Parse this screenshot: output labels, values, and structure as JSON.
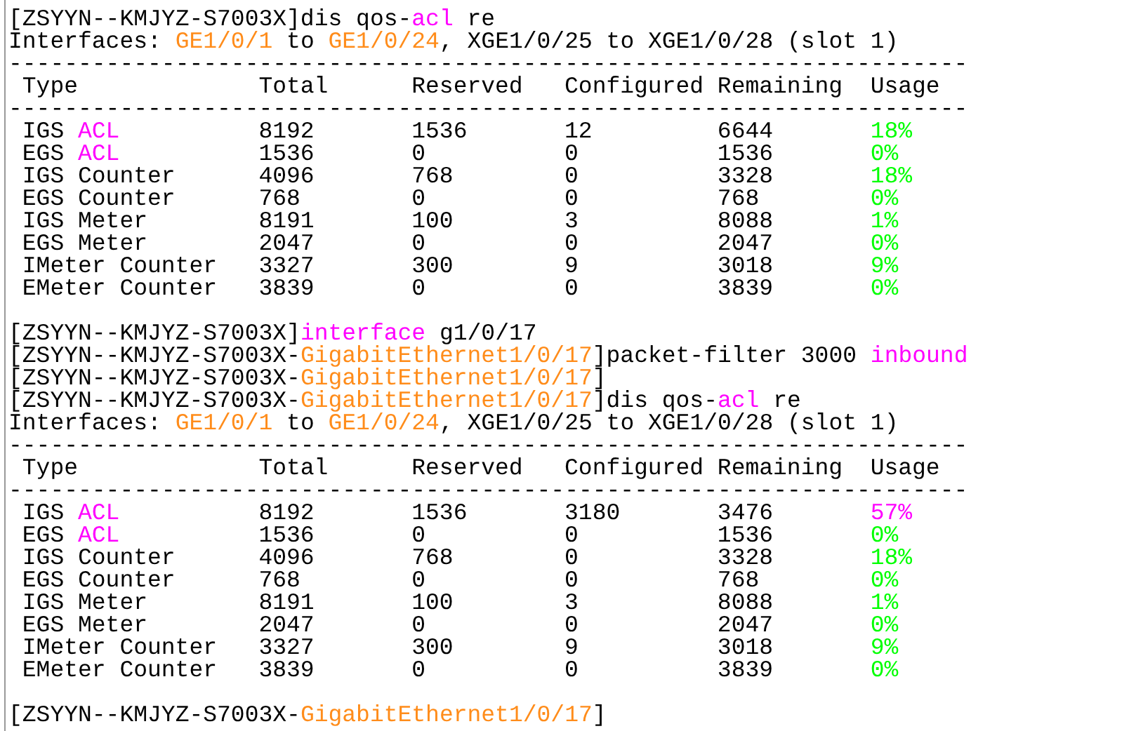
{
  "blocks": [
    {
      "kind": "line",
      "segments": [
        {
          "text": "[ZSYYN--KMJYZ-S7003X]dis qos-",
          "color": "#000000"
        },
        {
          "text": "acl",
          "color": "#ff00ff"
        },
        {
          "text": " re",
          "color": "#000000"
        }
      ]
    },
    {
      "kind": "line",
      "segments": [
        {
          "text": "Interfaces: ",
          "color": "#000000"
        },
        {
          "text": "GE1/0/1",
          "color": "#ff8c1a"
        },
        {
          "text": " to ",
          "color": "#000000"
        },
        {
          "text": "GE1/0/24",
          "color": "#ff8c1a"
        },
        {
          "text": ", XGE1/0/25 to XGE1/0/28 (slot 1)",
          "color": "#000000"
        }
      ]
    },
    {
      "kind": "table",
      "rule": "---------------------------------------------------------------------",
      "columns": [
        "Type",
        "Total",
        "Reserved",
        "Configured",
        "Remaining",
        "Usage"
      ],
      "rows": [
        {
          "type": [
            {
              "text": "IGS ",
              "color": "#000000"
            },
            {
              "text": "ACL",
              "color": "#ff00ff"
            }
          ],
          "total": "8192",
          "reserved": "1536",
          "configured": "12",
          "remaining": "6644",
          "usage": {
            "text": "18%",
            "color": "#00ff00"
          }
        },
        {
          "type": [
            {
              "text": "EGS ",
              "color": "#000000"
            },
            {
              "text": "ACL",
              "color": "#ff00ff"
            }
          ],
          "total": "1536",
          "reserved": "0",
          "configured": "0",
          "remaining": "1536",
          "usage": {
            "text": "0%",
            "color": "#00ff00"
          }
        },
        {
          "type": [
            {
              "text": "IGS Counter",
              "color": "#000000"
            }
          ],
          "total": "4096",
          "reserved": "768",
          "configured": "0",
          "remaining": "3328",
          "usage": {
            "text": "18%",
            "color": "#00ff00"
          }
        },
        {
          "type": [
            {
              "text": "EGS Counter",
              "color": "#000000"
            }
          ],
          "total": "768",
          "reserved": "0",
          "configured": "0",
          "remaining": "768",
          "usage": {
            "text": "0%",
            "color": "#00ff00"
          }
        },
        {
          "type": [
            {
              "text": "IGS Meter",
              "color": "#000000"
            }
          ],
          "total": "8191",
          "reserved": "100",
          "configured": "3",
          "remaining": "8088",
          "usage": {
            "text": "1%",
            "color": "#00ff00"
          }
        },
        {
          "type": [
            {
              "text": "EGS Meter",
              "color": "#000000"
            }
          ],
          "total": "2047",
          "reserved": "0",
          "configured": "0",
          "remaining": "2047",
          "usage": {
            "text": "0%",
            "color": "#00ff00"
          }
        },
        {
          "type": [
            {
              "text": "IMeter Counter",
              "color": "#000000"
            }
          ],
          "total": "3327",
          "reserved": "300",
          "configured": "9",
          "remaining": "3018",
          "usage": {
            "text": "9%",
            "color": "#00ff00"
          }
        },
        {
          "type": [
            {
              "text": "EMeter Counter",
              "color": "#000000"
            }
          ],
          "total": "3839",
          "reserved": "0",
          "configured": "0",
          "remaining": "3839",
          "usage": {
            "text": "0%",
            "color": "#00ff00"
          }
        }
      ]
    },
    {
      "kind": "blank"
    },
    {
      "kind": "line",
      "segments": [
        {
          "text": "[ZSYYN--KMJYZ-S7003X]",
          "color": "#000000"
        },
        {
          "text": "interface",
          "color": "#ff00ff"
        },
        {
          "text": " g1/0/17",
          "color": "#000000"
        }
      ]
    },
    {
      "kind": "line",
      "segments": [
        {
          "text": "[ZSYYN--KMJYZ-S7003X-",
          "color": "#000000"
        },
        {
          "text": "GigabitEthernet1/0/17",
          "color": "#ff8c1a"
        },
        {
          "text": "]packet-filter 3000 ",
          "color": "#000000"
        },
        {
          "text": "inbound",
          "color": "#ff00ff"
        }
      ]
    },
    {
      "kind": "line",
      "segments": [
        {
          "text": "[ZSYYN--KMJYZ-S7003X-",
          "color": "#000000"
        },
        {
          "text": "GigabitEthernet1/0/17",
          "color": "#ff8c1a"
        },
        {
          "text": "]",
          "color": "#000000"
        }
      ]
    },
    {
      "kind": "line",
      "segments": [
        {
          "text": "[ZSYYN--KMJYZ-S7003X-",
          "color": "#000000"
        },
        {
          "text": "GigabitEthernet1/0/17",
          "color": "#ff8c1a"
        },
        {
          "text": "]dis qos-",
          "color": "#000000"
        },
        {
          "text": "acl",
          "color": "#ff00ff"
        },
        {
          "text": " re",
          "color": "#000000"
        }
      ]
    },
    {
      "kind": "line",
      "segments": [
        {
          "text": "Interfaces: ",
          "color": "#000000"
        },
        {
          "text": "GE1/0/1",
          "color": "#ff8c1a"
        },
        {
          "text": " to ",
          "color": "#000000"
        },
        {
          "text": "GE1/0/24",
          "color": "#ff8c1a"
        },
        {
          "text": ", XGE1/0/25 to XGE1/0/28 (slot 1)",
          "color": "#000000"
        }
      ]
    },
    {
      "kind": "table",
      "rule": "---------------------------------------------------------------------",
      "columns": [
        "Type",
        "Total",
        "Reserved",
        "Configured",
        "Remaining",
        "Usage"
      ],
      "rows": [
        {
          "type": [
            {
              "text": "IGS ",
              "color": "#000000"
            },
            {
              "text": "ACL",
              "color": "#ff00ff"
            }
          ],
          "total": "8192",
          "reserved": "1536",
          "configured": "3180",
          "remaining": "3476",
          "usage": {
            "text": "57%",
            "color": "#ff00ff"
          }
        },
        {
          "type": [
            {
              "text": "EGS ",
              "color": "#000000"
            },
            {
              "text": "ACL",
              "color": "#ff00ff"
            }
          ],
          "total": "1536",
          "reserved": "0",
          "configured": "0",
          "remaining": "1536",
          "usage": {
            "text": "0%",
            "color": "#00ff00"
          }
        },
        {
          "type": [
            {
              "text": "IGS Counter",
              "color": "#000000"
            }
          ],
          "total": "4096",
          "reserved": "768",
          "configured": "0",
          "remaining": "3328",
          "usage": {
            "text": "18%",
            "color": "#00ff00"
          }
        },
        {
          "type": [
            {
              "text": "EGS Counter",
              "color": "#000000"
            }
          ],
          "total": "768",
          "reserved": "0",
          "configured": "0",
          "remaining": "768",
          "usage": {
            "text": "0%",
            "color": "#00ff00"
          }
        },
        {
          "type": [
            {
              "text": "IGS Meter",
              "color": "#000000"
            }
          ],
          "total": "8191",
          "reserved": "100",
          "configured": "3",
          "remaining": "8088",
          "usage": {
            "text": "1%",
            "color": "#00ff00"
          }
        },
        {
          "type": [
            {
              "text": "EGS Meter",
              "color": "#000000"
            }
          ],
          "total": "2047",
          "reserved": "0",
          "configured": "0",
          "remaining": "2047",
          "usage": {
            "text": "0%",
            "color": "#00ff00"
          }
        },
        {
          "type": [
            {
              "text": "IMeter Counter",
              "color": "#000000"
            }
          ],
          "total": "3327",
          "reserved": "300",
          "configured": "9",
          "remaining": "3018",
          "usage": {
            "text": "9%",
            "color": "#00ff00"
          }
        },
        {
          "type": [
            {
              "text": "EMeter Counter",
              "color": "#000000"
            }
          ],
          "total": "3839",
          "reserved": "0",
          "configured": "0",
          "remaining": "3839",
          "usage": {
            "text": "0%",
            "color": "#00ff00"
          }
        }
      ]
    },
    {
      "kind": "blank"
    },
    {
      "kind": "line",
      "segments": [
        {
          "text": "[ZSYYN--KMJYZ-S7003X-",
          "color": "#000000"
        },
        {
          "text": "GigabitEthernet1/0/17",
          "color": "#ff8c1a"
        },
        {
          "text": "]",
          "color": "#000000"
        }
      ]
    }
  ]
}
